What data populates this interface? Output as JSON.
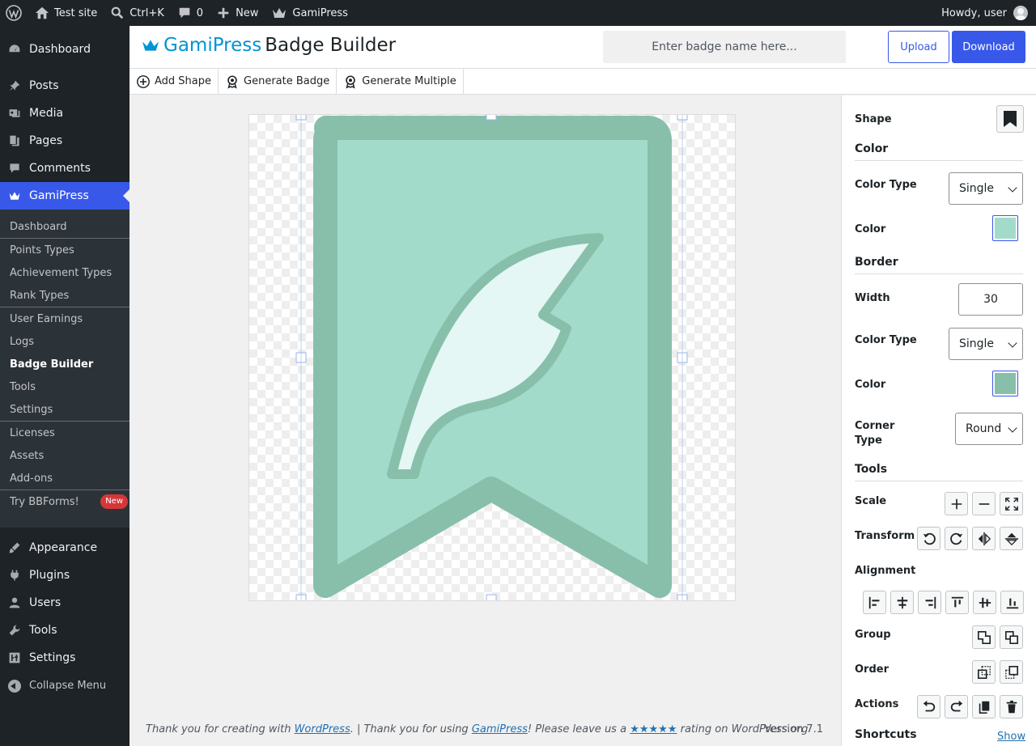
{
  "adminbar": {
    "site": "Test site",
    "search_shortcut": "Ctrl+K",
    "comments_count": "0",
    "new_label": "New",
    "gamipress": "GamiPress",
    "howdy": "Howdy, user"
  },
  "sidebar": {
    "top_items": [
      {
        "label": "Dashboard"
      },
      {
        "label": "Posts"
      },
      {
        "label": "Media"
      },
      {
        "label": "Pages"
      },
      {
        "label": "Comments"
      },
      {
        "label": "GamiPress"
      }
    ],
    "sub_items": [
      {
        "label": "Dashboard"
      },
      {
        "label": "Points Types"
      },
      {
        "label": "Achievement Types"
      },
      {
        "label": "Rank Types"
      },
      {
        "label": "User Earnings"
      },
      {
        "label": "Logs"
      },
      {
        "label": "Badge Builder"
      },
      {
        "label": "Tools"
      },
      {
        "label": "Settings"
      },
      {
        "label": "Licenses"
      },
      {
        "label": "Assets"
      },
      {
        "label": "Add-ons"
      },
      {
        "label": "Try BBForms!"
      }
    ],
    "new_badge": "New",
    "bottom_items": [
      {
        "label": "Appearance"
      },
      {
        "label": "Plugins"
      },
      {
        "label": "Users"
      },
      {
        "label": "Tools"
      },
      {
        "label": "Settings"
      }
    ],
    "collapse": "Collapse Menu"
  },
  "header": {
    "brand": "GamiPress",
    "title": "Badge Builder",
    "name_placeholder": "Enter badge name here...",
    "upload": "Upload",
    "download": "Download"
  },
  "toolbar": {
    "add_shape": "Add Shape",
    "generate_badge": "Generate Badge",
    "generate_multiple": "Generate Multiple"
  },
  "badge": {
    "fill_color": "#a3dbcb",
    "border_color": "#88bfab",
    "icon_fill": "#e4f7f4",
    "handle_color": "#9ab4e8"
  },
  "panel": {
    "shape_label": "Shape",
    "color_heading": "Color",
    "color_type_label": "Color Type",
    "color_type_value": "Single",
    "color_label": "Color",
    "color_value": "#a3dbcb",
    "border_heading": "Border",
    "width_label": "Width",
    "width_value": "30",
    "border_color_type_label": "Color Type",
    "border_color_type_value": "Single",
    "border_color_label": "Color",
    "border_color_value": "#88bfab",
    "corner_type_label": "Corner Type",
    "corner_type_value": "Round",
    "tools_heading": "Tools",
    "scale_label": "Scale",
    "transform_label": "Transform",
    "alignment_label": "Alignment",
    "group_label": "Group",
    "order_label": "Order",
    "actions_label": "Actions",
    "shortcuts_heading": "Shortcuts",
    "shortcuts_show": "Show"
  },
  "footer": {
    "text_1": "Thank you for creating with ",
    "wordpress_link": "WordPress",
    "text_2": ". | Thank you for using ",
    "gamipress_link": "GamiPress",
    "text_3": "! Please leave us a ",
    "stars": "★★★★★",
    "text_4": " rating on WordPress.org",
    "version": "Version 7.1"
  }
}
